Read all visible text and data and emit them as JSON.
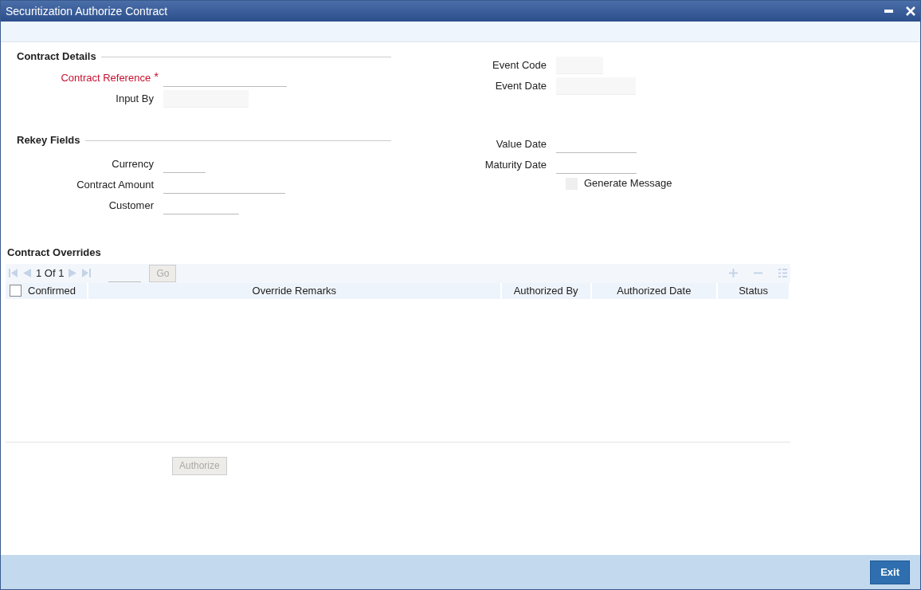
{
  "window": {
    "title": "Securitization Authorize Contract"
  },
  "left_sections": [
    {
      "title": "Contract Details",
      "fields": [
        {
          "label": "Contract Reference",
          "required": true,
          "required_mark": "*",
          "kind": "underline"
        },
        {
          "label": "Input By",
          "required": false,
          "kind": "filled"
        }
      ]
    },
    {
      "title": "Rekey Fields",
      "fields": [
        {
          "label": "Currency",
          "required": false,
          "kind": "underline"
        },
        {
          "label": "Contract Amount",
          "required": false,
          "kind": "underline"
        },
        {
          "label": "Customer",
          "required": false,
          "kind": "underline"
        }
      ]
    }
  ],
  "right_groups": [
    {
      "fields": [
        {
          "label": "Event Code",
          "kind": "filled"
        },
        {
          "label": "Event Date",
          "kind": "filled"
        }
      ]
    },
    {
      "fields": [
        {
          "label": "Value Date",
          "kind": "underline"
        },
        {
          "label": "Maturity Date",
          "kind": "underline"
        }
      ],
      "checkbox": {
        "label": "Generate Message",
        "checked": false,
        "disabled": true
      }
    }
  ],
  "overrides": {
    "title": "Contract Overrides",
    "pager": "1 Of 1",
    "go_button": {
      "label": "Go",
      "disabled": true
    },
    "select_all": {
      "checked": false
    },
    "columns": [
      "Confirmed",
      "Override Remarks",
      "Authorized By",
      "Authorized Date",
      "Status"
    ]
  },
  "authorize_button": {
    "label": "Authorize",
    "disabled": true
  },
  "exit_button": {
    "label": "Exit",
    "disabled": false
  }
}
